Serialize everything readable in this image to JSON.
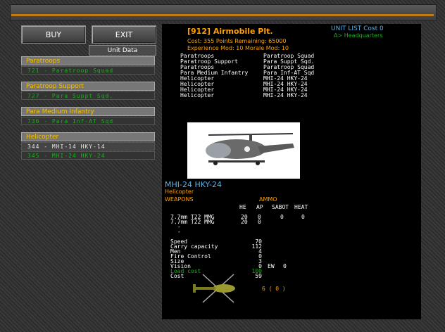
{
  "toolbar": {
    "buy_label": "BUY",
    "exit_label": "EXIT",
    "unit_data_label": "Unit Data"
  },
  "categories": [
    {
      "name": "Paratroops",
      "items": [
        {
          "label": "721 - Paratroop Squad",
          "selected": false
        }
      ]
    },
    {
      "name": "Paratroop Support",
      "items": [
        {
          "label": "727 - Para Suppt Sqd.",
          "selected": false
        }
      ]
    },
    {
      "name": "Para Medium Infantry",
      "items": [
        {
          "label": "736 - Para Inf-AT Sqd",
          "selected": false
        }
      ]
    },
    {
      "name": "Helicopter",
      "items": [
        {
          "label": "344 - MHI-14 HKY-14",
          "selected": true
        },
        {
          "label": "345 - MHI-24 HKY-24",
          "selected": false
        }
      ]
    }
  ],
  "formation": {
    "title": "[912] Airmobile Plt.",
    "cost_label": "Cost:",
    "cost": "355",
    "points_label": "Points Remaining:",
    "points": "65000",
    "exp_label": "Experience Mod:",
    "exp": "10",
    "morale_label": "Morale Mod:",
    "morale": "10"
  },
  "unit_list": {
    "label": "UNIT LIST",
    "cost_label": "Cost",
    "cost": "0",
    "hq": "A> Headquarters"
  },
  "roster": [
    [
      "Paratroops",
      "Paratroop Squad"
    ],
    [
      "Paratroop Support",
      "Para Suppt Sqd."
    ],
    [
      "Paratroops",
      "Paratroop Squad"
    ],
    [
      "Para Medium Infantry",
      "Para Inf-AT Sqd"
    ],
    [
      "Helicopter",
      "MHI-24 HKY-24"
    ],
    [
      "Helicopter",
      "MHI-24 HKY-24"
    ],
    [
      "Helicopter",
      "MHI-24 HKY-24"
    ],
    [
      "Helicopter",
      "MHI-24 HKY-24"
    ]
  ],
  "unit": {
    "name": "MHI-24 HKY-24",
    "class": "Helicopter",
    "weapons_label": "WEAPONS",
    "ammo_label": "AMMO",
    "cols": {
      "he": "HE",
      "ap": "AP",
      "sabot": "SABOT",
      "heat": "HEAT"
    },
    "weapons": [
      {
        "name": "7.7mm T22 MMG",
        "he": "20",
        "ap": "0",
        "sabot": "0",
        "heat": "0"
      },
      {
        "name": "7.7mm T22 MMG",
        "he": "20",
        "ap": "0",
        "sabot": "",
        "heat": ""
      }
    ],
    "empty_slots": [
      "-",
      "-"
    ],
    "stats": [
      {
        "label": "Speed",
        "value": "70"
      },
      {
        "label": "Carry capacity",
        "value": "112"
      },
      {
        "label": "Men",
        "value": "4"
      },
      {
        "label": "Fire Control",
        "value": "0"
      },
      {
        "label": "Size",
        "value": "3"
      },
      {
        "label": "Vision",
        "value": "0"
      },
      {
        "label": "Load cost",
        "value": "100"
      },
      {
        "label": "Cost",
        "value": "59"
      }
    ],
    "ew_label": "EW",
    "ew": "0",
    "count": "6 ( 0 )"
  },
  "colors": {
    "accent": "#ffa000",
    "unit_name": "#60b0e0",
    "item_green": "#18b018"
  }
}
